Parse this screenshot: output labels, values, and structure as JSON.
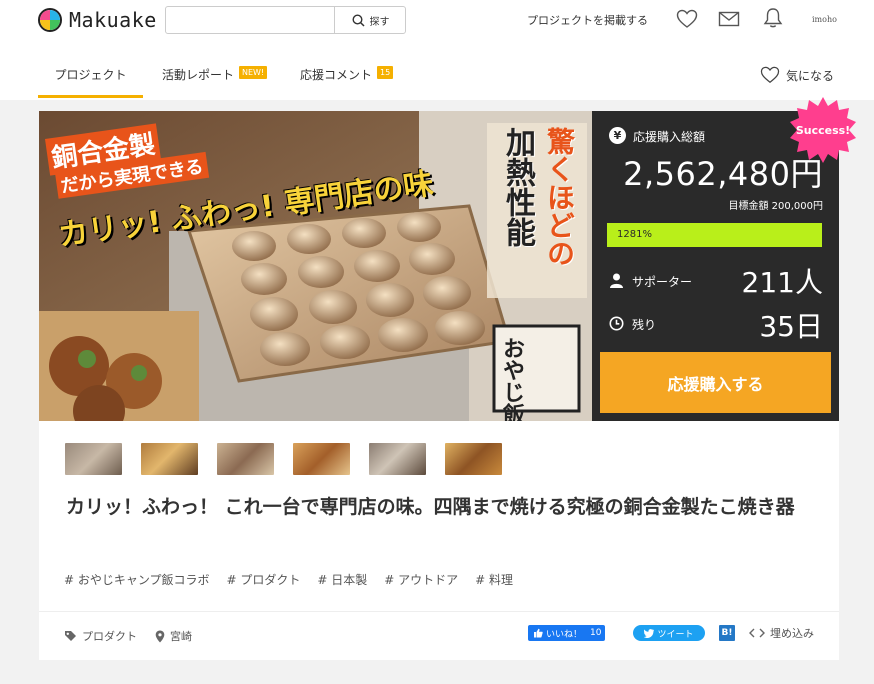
{
  "header": {
    "logo_text": "Makuake",
    "search": {
      "value": "",
      "placeholder": "",
      "button_label": "探す"
    },
    "post_project_label": "プロジェクトを掲載する",
    "username": "imoho",
    "icons": [
      "heart-icon",
      "mail-icon",
      "bell-icon"
    ]
  },
  "tabs": [
    {
      "label": "プロジェクト",
      "active": true
    },
    {
      "label": "活動レポート",
      "badge": "NEW!"
    },
    {
      "label": "応援コメント",
      "badge": "15"
    }
  ],
  "favorite_label": "気になる",
  "hero": {
    "text_1": "銅合金製",
    "text_2": "だから実現できる",
    "text_3": "カリッ! ふわっ! 専門店の味",
    "text_4": "驚くほどの",
    "text_5": "加熱性能",
    "logo_text": "おやじ飯"
  },
  "funding": {
    "total_label": "応援購入総額",
    "total_amount": "2,562,480円",
    "target_label": "目標金額",
    "target_amount": "200,000円",
    "progress_text": "1281%",
    "progress_fraction": 1.0,
    "supporters_label": "サポーター",
    "supporters_value": "211人",
    "remaining_label": "残り",
    "remaining_value": "35日",
    "buy_label": "応援購入する",
    "success_label": "Success!"
  },
  "thumbnails_count": 6,
  "title": "カリッ！ふわっ！ これ一台で専門店の味。四隅まで焼ける究極の銅合金製たこ焼き器",
  "tags": [
    "# おやじキャンプ飯コラボ",
    "# プロダクト",
    "# 日本製",
    "# アウトドア",
    "# 料理"
  ],
  "meta": {
    "category": "プロダクト",
    "location": "宮崎"
  },
  "share": {
    "facebook_label": "いいね！",
    "facebook_count": "10",
    "twitter_label": "ツイート",
    "hatena_label": "B!",
    "embed_label": "埋め込み"
  },
  "colors": {
    "accent": "#f5b000",
    "buy_button": "#f5a623",
    "progress": "#b9ef1a",
    "panel_bg": "#2a2a2a",
    "success_badge": "#ff3e8e",
    "hero_orange": "#e8541a"
  }
}
